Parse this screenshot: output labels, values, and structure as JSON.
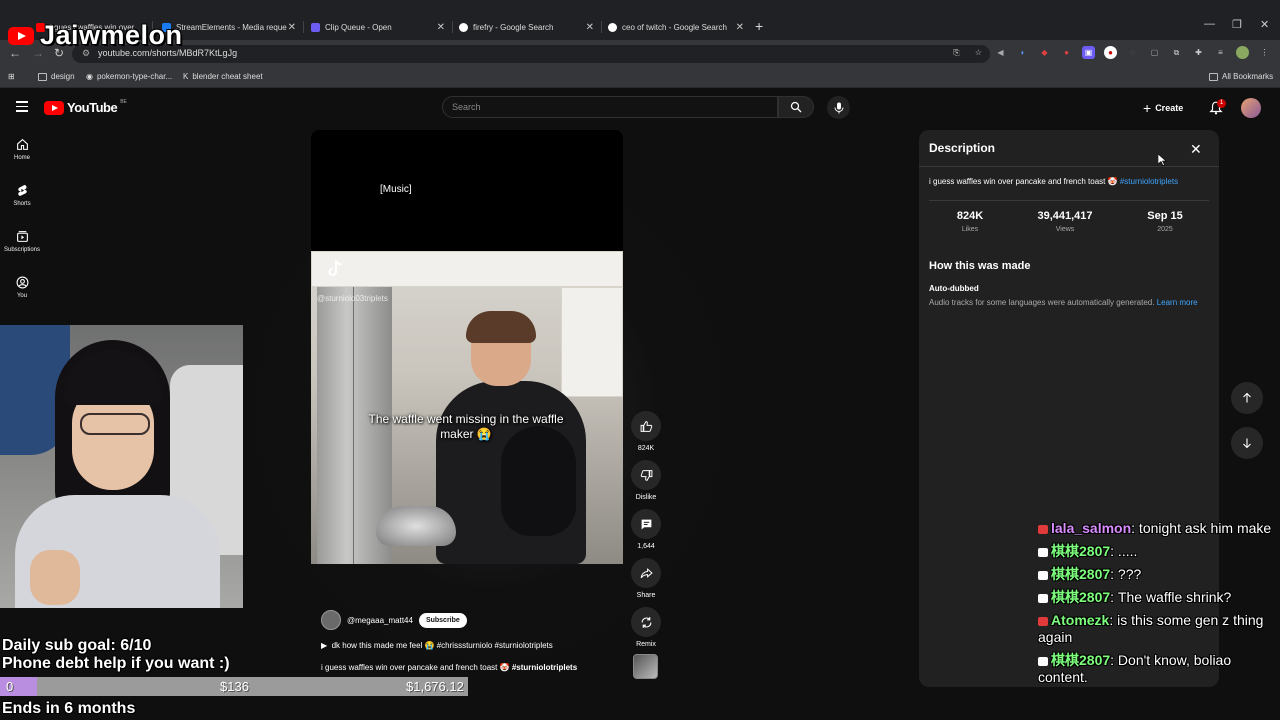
{
  "browser": {
    "tabs": [
      {
        "title": "i guess waffles win over"
      },
      {
        "title": "StreamElements - Media reque"
      },
      {
        "title": "Clip Queue - Open"
      },
      {
        "title": "firefry - Google Search"
      },
      {
        "title": "ceo of twitch - Google Search"
      }
    ],
    "url": "youtube.com/shorts/MBdR7KtLgJg",
    "bookmarks": [
      "design",
      "pokemon-type-char...",
      "blender cheat sheet"
    ],
    "all_bookmarks": "All Bookmarks"
  },
  "overlay": {
    "streamer_name": "Jaiwmelon",
    "goal_line1": "Daily sub goal: 6/10",
    "goal_line2": "Phone debt help if you want :)",
    "donation_current": "0",
    "donation_mid": "$136",
    "donation_total": "$1,676.12",
    "donation_progress": 0.08,
    "ends": "Ends in 6 months"
  },
  "youtube": {
    "logo_text": "YouTube",
    "country": "BE",
    "search_placeholder": "Search",
    "create_label": "Create",
    "notif_count": "1",
    "nav": [
      {
        "label": "Home"
      },
      {
        "label": "Shorts"
      },
      {
        "label": "Subscriptions"
      },
      {
        "label": "You"
      }
    ]
  },
  "short": {
    "music_caption": "[Music]",
    "tiktok_user": "@sturniolo03triplets",
    "subtitle": "The waffle went missing in the waffle maker 😭",
    "channel": "@megaaa_matt44",
    "subscribe_label": "Subscribe",
    "sound": "dk how this made me feel 😭 #chrisssturniolo #sturniolotriplets",
    "title": "i guess waffles win over pancake and french toast 🤡",
    "title_tag": "#sturniolotriplets",
    "actions": {
      "likes": "824K",
      "dislike": "Dislike",
      "comments": "1,644",
      "share": "Share",
      "remix": "Remix"
    }
  },
  "description": {
    "heading": "Description",
    "text": "i guess waffles win over pancake and french toast 🤡",
    "tag": "#sturniolotriplets",
    "stats": [
      {
        "value": "824K",
        "label": "Likes"
      },
      {
        "value": "39,441,417",
        "label": "Views"
      },
      {
        "value": "Sep 15",
        "label": "2025"
      }
    ],
    "how_made": "How this was made",
    "auto_dubbed": "Auto-dubbed",
    "auto_dubbed_text": "Audio tracks for some languages were automatically generated.",
    "learn_more": "Learn more"
  },
  "chat": [
    {
      "user": "lala_salmon",
      "color": "#d98cff",
      "msg": "tonight ask him make"
    },
    {
      "user": "棋棋2807",
      "color": "#7dff7d",
      "msg": "....."
    },
    {
      "user": "棋棋2807",
      "color": "#7dff7d",
      "msg": "???"
    },
    {
      "user": "棋棋2807",
      "color": "#7dff7d",
      "msg": "The waffle shrink?"
    },
    {
      "user": "Atomezk",
      "color": "#7dff7d",
      "msg": "is this some gen z thing again"
    },
    {
      "user": "棋棋2807",
      "color": "#7dff7d",
      "msg": "Don't know, boliao content."
    }
  ],
  "colors": {
    "yt_red": "#ff0000",
    "link_blue": "#3ea6ff",
    "panel_bg": "#212121",
    "page_bg": "#0f0f0f",
    "bar_fill": "#b98ee0"
  }
}
